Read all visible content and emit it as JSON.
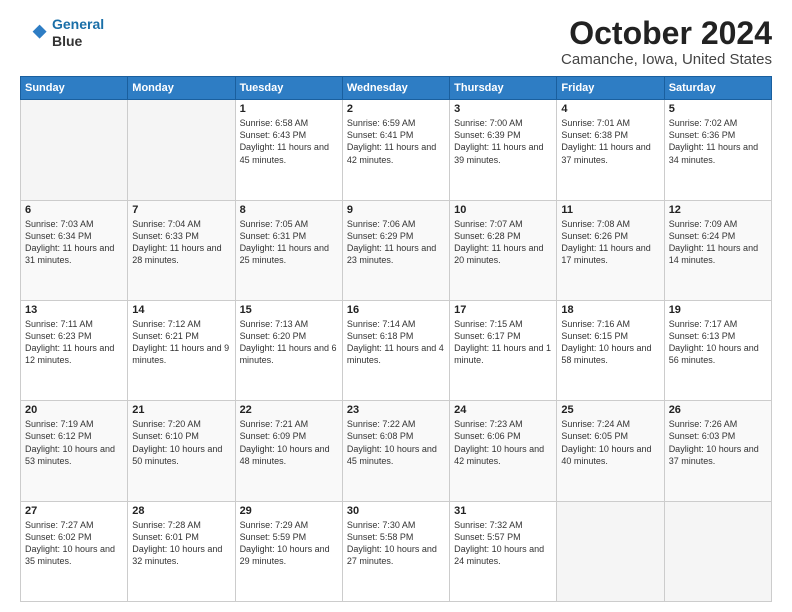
{
  "header": {
    "logo_line1": "General",
    "logo_line2": "Blue",
    "title": "October 2024",
    "subtitle": "Camanche, Iowa, United States"
  },
  "weekdays": [
    "Sunday",
    "Monday",
    "Tuesday",
    "Wednesday",
    "Thursday",
    "Friday",
    "Saturday"
  ],
  "weeks": [
    [
      {
        "day": "",
        "info": ""
      },
      {
        "day": "",
        "info": ""
      },
      {
        "day": "1",
        "info": "Sunrise: 6:58 AM\nSunset: 6:43 PM\nDaylight: 11 hours and 45 minutes."
      },
      {
        "day": "2",
        "info": "Sunrise: 6:59 AM\nSunset: 6:41 PM\nDaylight: 11 hours and 42 minutes."
      },
      {
        "day": "3",
        "info": "Sunrise: 7:00 AM\nSunset: 6:39 PM\nDaylight: 11 hours and 39 minutes."
      },
      {
        "day": "4",
        "info": "Sunrise: 7:01 AM\nSunset: 6:38 PM\nDaylight: 11 hours and 37 minutes."
      },
      {
        "day": "5",
        "info": "Sunrise: 7:02 AM\nSunset: 6:36 PM\nDaylight: 11 hours and 34 minutes."
      }
    ],
    [
      {
        "day": "6",
        "info": "Sunrise: 7:03 AM\nSunset: 6:34 PM\nDaylight: 11 hours and 31 minutes."
      },
      {
        "day": "7",
        "info": "Sunrise: 7:04 AM\nSunset: 6:33 PM\nDaylight: 11 hours and 28 minutes."
      },
      {
        "day": "8",
        "info": "Sunrise: 7:05 AM\nSunset: 6:31 PM\nDaylight: 11 hours and 25 minutes."
      },
      {
        "day": "9",
        "info": "Sunrise: 7:06 AM\nSunset: 6:29 PM\nDaylight: 11 hours and 23 minutes."
      },
      {
        "day": "10",
        "info": "Sunrise: 7:07 AM\nSunset: 6:28 PM\nDaylight: 11 hours and 20 minutes."
      },
      {
        "day": "11",
        "info": "Sunrise: 7:08 AM\nSunset: 6:26 PM\nDaylight: 11 hours and 17 minutes."
      },
      {
        "day": "12",
        "info": "Sunrise: 7:09 AM\nSunset: 6:24 PM\nDaylight: 11 hours and 14 minutes."
      }
    ],
    [
      {
        "day": "13",
        "info": "Sunrise: 7:11 AM\nSunset: 6:23 PM\nDaylight: 11 hours and 12 minutes."
      },
      {
        "day": "14",
        "info": "Sunrise: 7:12 AM\nSunset: 6:21 PM\nDaylight: 11 hours and 9 minutes."
      },
      {
        "day": "15",
        "info": "Sunrise: 7:13 AM\nSunset: 6:20 PM\nDaylight: 11 hours and 6 minutes."
      },
      {
        "day": "16",
        "info": "Sunrise: 7:14 AM\nSunset: 6:18 PM\nDaylight: 11 hours and 4 minutes."
      },
      {
        "day": "17",
        "info": "Sunrise: 7:15 AM\nSunset: 6:17 PM\nDaylight: 11 hours and 1 minute."
      },
      {
        "day": "18",
        "info": "Sunrise: 7:16 AM\nSunset: 6:15 PM\nDaylight: 10 hours and 58 minutes."
      },
      {
        "day": "19",
        "info": "Sunrise: 7:17 AM\nSunset: 6:13 PM\nDaylight: 10 hours and 56 minutes."
      }
    ],
    [
      {
        "day": "20",
        "info": "Sunrise: 7:19 AM\nSunset: 6:12 PM\nDaylight: 10 hours and 53 minutes."
      },
      {
        "day": "21",
        "info": "Sunrise: 7:20 AM\nSunset: 6:10 PM\nDaylight: 10 hours and 50 minutes."
      },
      {
        "day": "22",
        "info": "Sunrise: 7:21 AM\nSunset: 6:09 PM\nDaylight: 10 hours and 48 minutes."
      },
      {
        "day": "23",
        "info": "Sunrise: 7:22 AM\nSunset: 6:08 PM\nDaylight: 10 hours and 45 minutes."
      },
      {
        "day": "24",
        "info": "Sunrise: 7:23 AM\nSunset: 6:06 PM\nDaylight: 10 hours and 42 minutes."
      },
      {
        "day": "25",
        "info": "Sunrise: 7:24 AM\nSunset: 6:05 PM\nDaylight: 10 hours and 40 minutes."
      },
      {
        "day": "26",
        "info": "Sunrise: 7:26 AM\nSunset: 6:03 PM\nDaylight: 10 hours and 37 minutes."
      }
    ],
    [
      {
        "day": "27",
        "info": "Sunrise: 7:27 AM\nSunset: 6:02 PM\nDaylight: 10 hours and 35 minutes."
      },
      {
        "day": "28",
        "info": "Sunrise: 7:28 AM\nSunset: 6:01 PM\nDaylight: 10 hours and 32 minutes."
      },
      {
        "day": "29",
        "info": "Sunrise: 7:29 AM\nSunset: 5:59 PM\nDaylight: 10 hours and 29 minutes."
      },
      {
        "day": "30",
        "info": "Sunrise: 7:30 AM\nSunset: 5:58 PM\nDaylight: 10 hours and 27 minutes."
      },
      {
        "day": "31",
        "info": "Sunrise: 7:32 AM\nSunset: 5:57 PM\nDaylight: 10 hours and 24 minutes."
      },
      {
        "day": "",
        "info": ""
      },
      {
        "day": "",
        "info": ""
      }
    ]
  ]
}
